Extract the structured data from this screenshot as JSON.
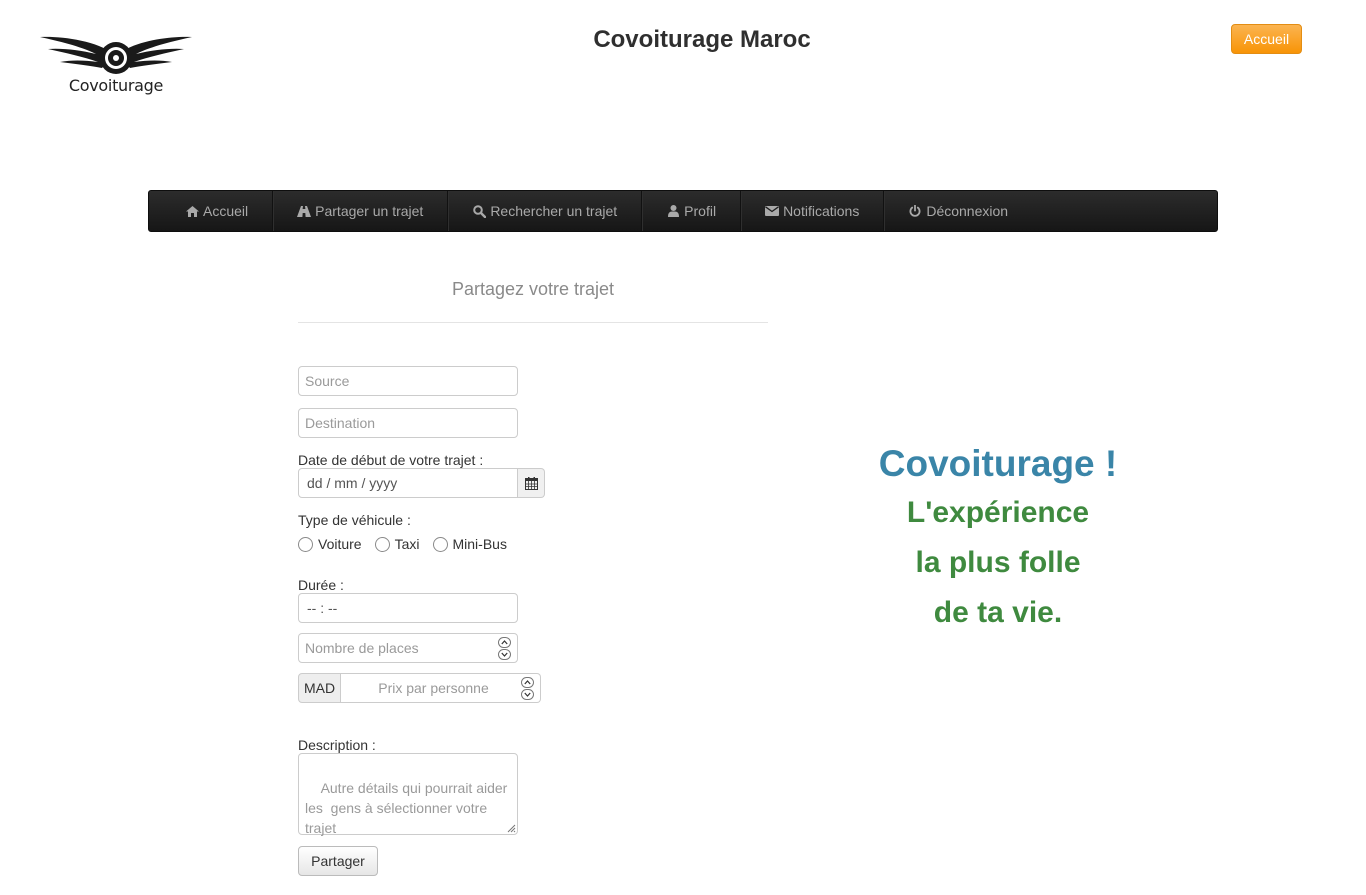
{
  "header": {
    "logo_text": "Covoiturage",
    "site_title": "Covoiturage Maroc",
    "top_button": "Accueil"
  },
  "colors": {
    "accent_orange": "#f89406",
    "navbar_bg": "#1b1b1b",
    "promo_blue": "#3a85a8",
    "promo_green": "#3f8a3f"
  },
  "nav": {
    "items": [
      {
        "label": "Accueil",
        "icon": "home-icon"
      },
      {
        "label": "Partager un trajet",
        "icon": "road-icon"
      },
      {
        "label": "Rechercher un trajet",
        "icon": "search-icon"
      },
      {
        "label": "Profil",
        "icon": "user-icon"
      },
      {
        "label": "Notifications",
        "icon": "envelope-icon"
      },
      {
        "label": "Déconnexion",
        "icon": "power-icon"
      }
    ]
  },
  "form": {
    "heading": "Partagez votre trajet",
    "source_placeholder": "Source",
    "destination_placeholder": "Destination",
    "date_label": "Date de début de votre trajet :",
    "date_placeholder": "dd / mm / yyyy",
    "vehicle_label": "Type de véhicule :",
    "vehicle_options": [
      "Voiture",
      "Taxi",
      "Mini-Bus"
    ],
    "duration_label": "Durée :",
    "duration_placeholder": "-- : --",
    "places_placeholder": "Nombre de places",
    "currency": "MAD",
    "price_placeholder": "Prix par personne",
    "description_label": "Description :",
    "description_placeholder": "Autre détails qui pourrait aider les  gens à sélectionner votre trajet",
    "submit": "Partager"
  },
  "promo": {
    "title": "Covoiturage !",
    "lines": [
      "L'expérience",
      "la plus folle",
      "de ta vie."
    ]
  }
}
